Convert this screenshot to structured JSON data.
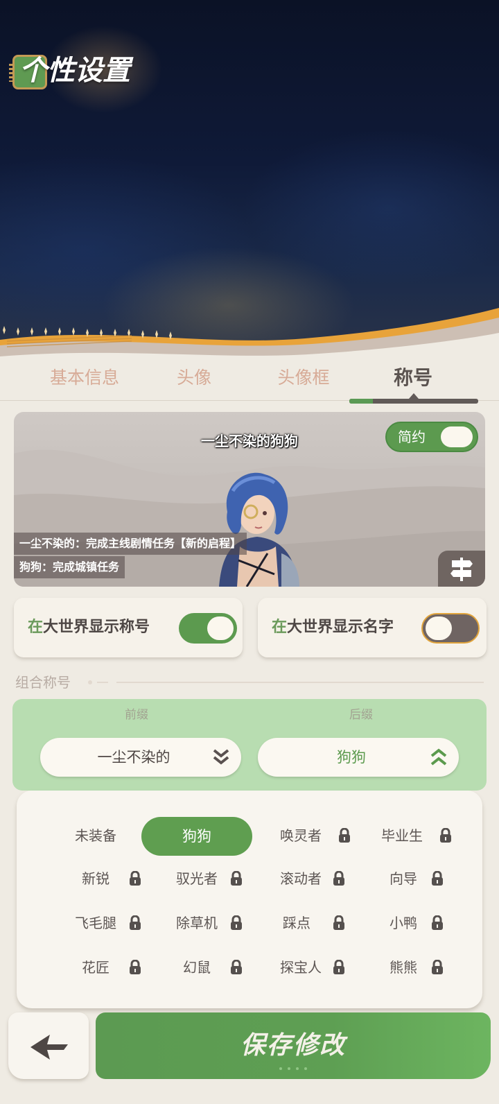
{
  "page": {
    "title": "个性设置"
  },
  "tabs": [
    {
      "label": "基本信息",
      "active": false
    },
    {
      "label": "头像",
      "active": false
    },
    {
      "label": "头像框",
      "active": false
    },
    {
      "label": "称号",
      "active": true
    }
  ],
  "preview": {
    "title_text": "一尘不染的狗狗",
    "simple_toggle": {
      "label": "简约",
      "on": true
    },
    "desc_lines": [
      "一尘不染的：完成主线剧情任务【新的启程】",
      "狗狗：完成城镇任务"
    ],
    "map_icon": "signpost-icon"
  },
  "switches": [
    {
      "accent": "在",
      "rest": "大世界显示称号",
      "on": true
    },
    {
      "accent": "在",
      "rest": "大世界显示名字",
      "on": false
    }
  ],
  "combo": {
    "section_title": "组合称号",
    "prefix_label": "前缀",
    "suffix_label": "后缀",
    "prefix_value": "一尘不染的",
    "suffix_value": "狗狗"
  },
  "title_list": {
    "selected": "狗狗",
    "items": [
      {
        "label": "未装备",
        "locked": false
      },
      {
        "label": "狗狗",
        "locked": false,
        "selected": true
      },
      {
        "label": "唤灵者",
        "locked": true
      },
      {
        "label": "毕业生",
        "locked": true
      },
      {
        "label": "新锐",
        "locked": true
      },
      {
        "label": "驭光者",
        "locked": true
      },
      {
        "label": "滚动者",
        "locked": true
      },
      {
        "label": "向导",
        "locked": true
      },
      {
        "label": "飞毛腿",
        "locked": true
      },
      {
        "label": "除草机",
        "locked": true
      },
      {
        "label": "踩点",
        "locked": true
      },
      {
        "label": "小鸭",
        "locked": true
      },
      {
        "label": "花匠",
        "locked": true
      },
      {
        "label": "幻鼠",
        "locked": true
      },
      {
        "label": "探宝人",
        "locked": true
      },
      {
        "label": "熊熊",
        "locked": true
      }
    ]
  },
  "footer": {
    "back_icon": "back-arrow-icon",
    "save_label": "保存修改"
  },
  "colors": {
    "accent_green": "#5c9a4f",
    "tab_inactive": "#d7ab97",
    "combo_bg": "#b8ddb1",
    "panel_bg": "#f8f5ef"
  }
}
